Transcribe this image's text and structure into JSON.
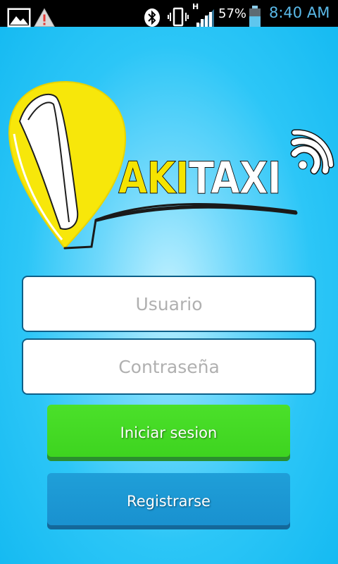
{
  "status_bar": {
    "icons": [
      "gallery-icon",
      "warning-icon",
      "bluetooth-icon",
      "vibrate-icon",
      "signal-icon",
      "battery-icon"
    ],
    "network_label": "H",
    "battery_percent": "57%",
    "battery_level": 0.57,
    "time": "8:40 AM",
    "clock_color": "#5ab9e8"
  },
  "logo": {
    "text_aki": "AKI",
    "text_taxi": "TAXI",
    "aki_color": "#f5e400",
    "taxi_color": "#ffffff"
  },
  "form": {
    "username_placeholder": "Usuario",
    "username_value": "",
    "password_placeholder": "Contraseña",
    "password_value": ""
  },
  "buttons": {
    "login_label": "Iniciar sesion",
    "login_color": "#3dd31f",
    "register_label": "Registrarse",
    "register_color": "#1990cf"
  },
  "background_color": "#2cc6f7"
}
